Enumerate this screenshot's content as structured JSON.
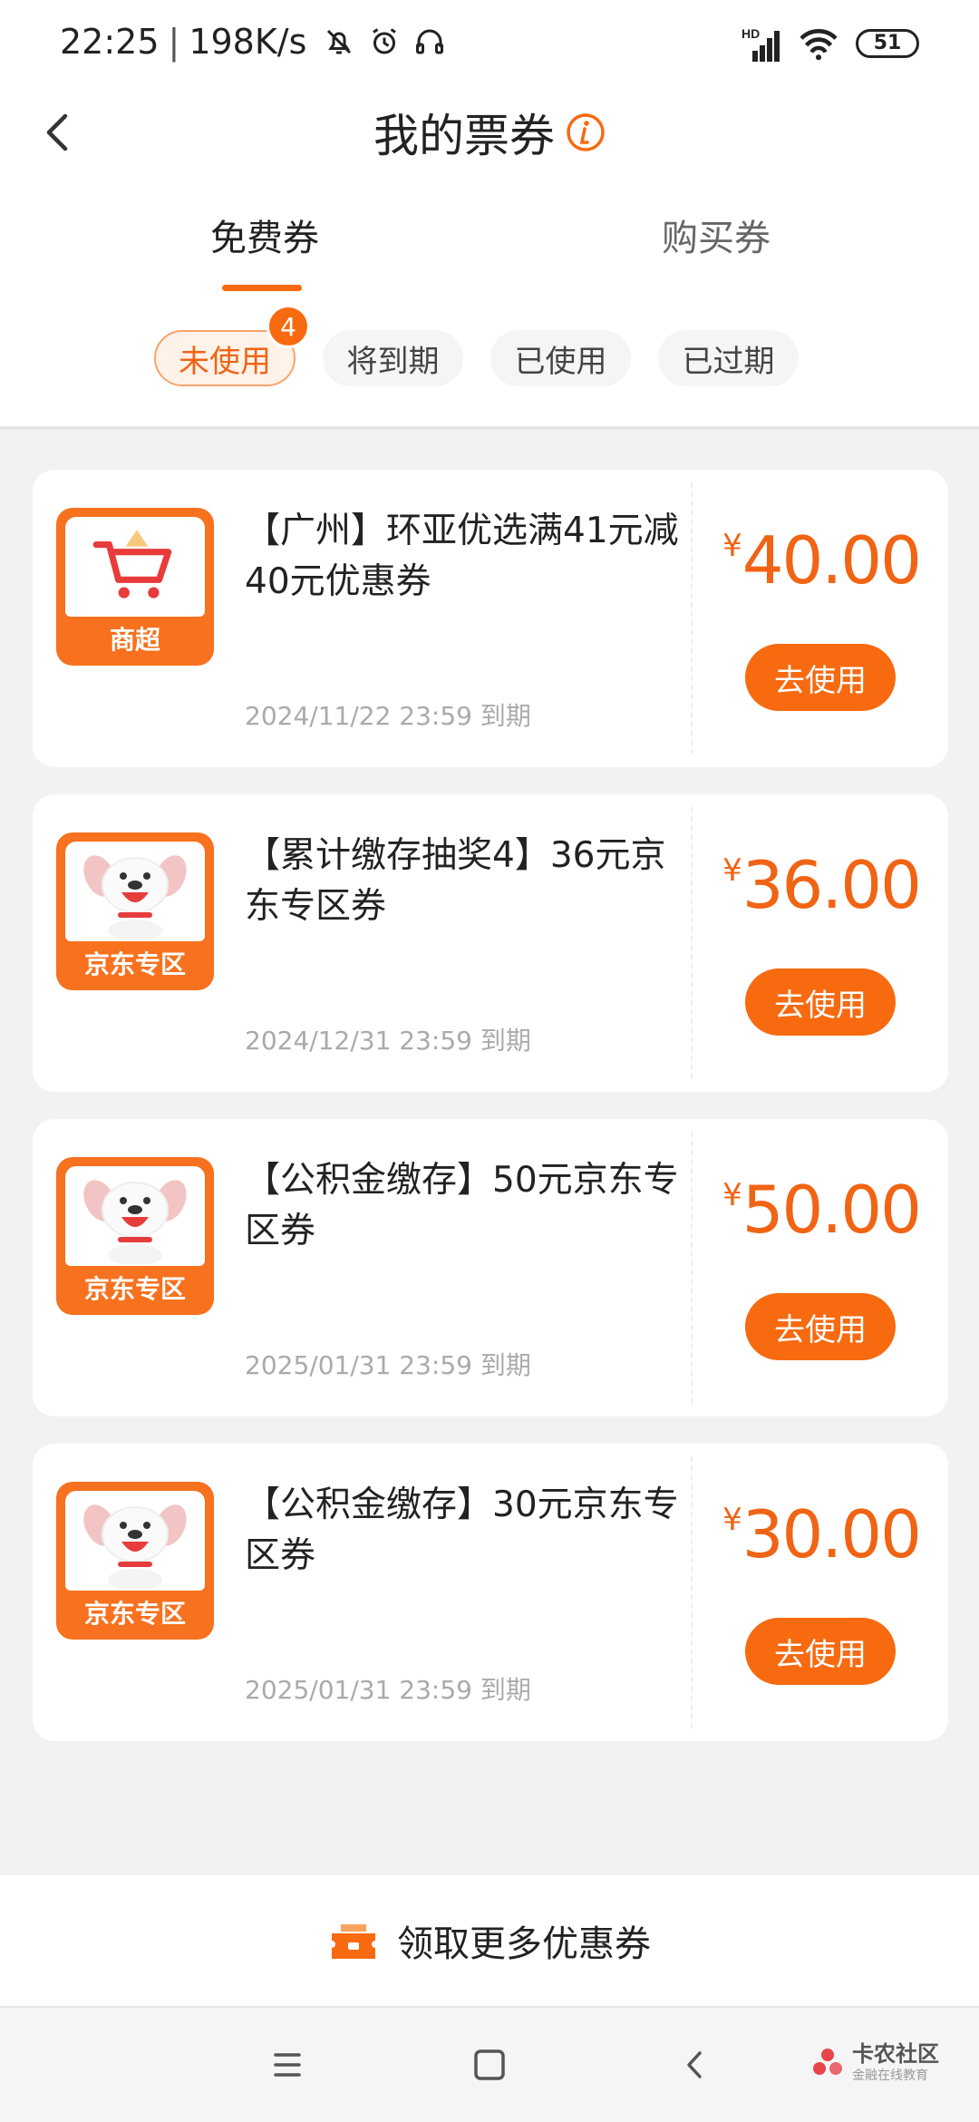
{
  "status_bar": {
    "time": "22:25",
    "speed": "198K/s",
    "battery": "51",
    "signal_label": "HD"
  },
  "header": {
    "title": "我的票券",
    "back_icon": "chevron-left-icon",
    "info_icon": "info-icon"
  },
  "tabs": [
    {
      "label": "免费券",
      "active": true
    },
    {
      "label": "购买券",
      "active": false
    }
  ],
  "filters": [
    {
      "label": "未使用",
      "active": true,
      "badge": "4"
    },
    {
      "label": "将到期",
      "active": false
    },
    {
      "label": "已使用",
      "active": false
    },
    {
      "label": "已过期",
      "active": false
    }
  ],
  "coupons": [
    {
      "icon_label": "商超",
      "icon": "shopping-cart-icon",
      "title": "【广州】环亚优选满41元减40元优惠券",
      "expiry": "2024/11/22 23:59 到期",
      "currency": "¥",
      "amount": "40.00",
      "button": "去使用"
    },
    {
      "icon_label": "京东专区",
      "icon": "jd-dog-icon",
      "title": "【累计缴存抽奖4】36元京东专区券",
      "expiry": "2024/12/31 23:59 到期",
      "currency": "¥",
      "amount": "36.00",
      "button": "去使用"
    },
    {
      "icon_label": "京东专区",
      "icon": "jd-dog-icon",
      "title": "【公积金缴存】50元京东专区券",
      "expiry": "2025/01/31 23:59 到期",
      "currency": "¥",
      "amount": "50.00",
      "button": "去使用"
    },
    {
      "icon_label": "京东专区",
      "icon": "jd-dog-icon",
      "title": "【公积金缴存】30元京东专区券",
      "expiry": "2025/01/31 23:59 到期",
      "currency": "¥",
      "amount": "30.00",
      "button": "去使用"
    }
  ],
  "footer": {
    "get_more_label": "领取更多优惠券",
    "icon": "ticket-icon"
  },
  "watermark": {
    "title": "卡农社区",
    "subtitle": "金融在线教育"
  },
  "colors": {
    "accent": "#f76a10",
    "price": "#f06414"
  }
}
